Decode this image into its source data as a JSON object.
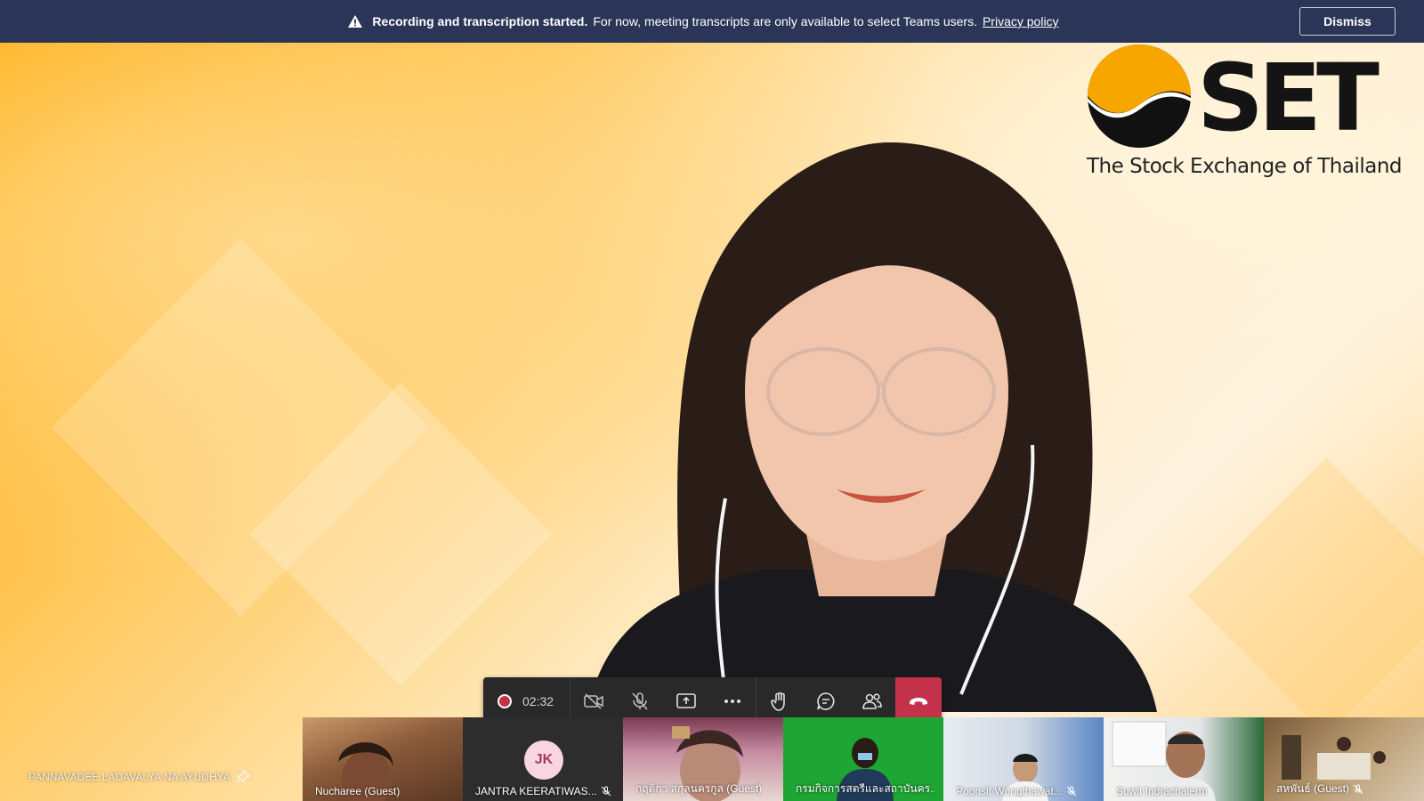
{
  "banner": {
    "title": "Recording and transcription started.",
    "message": "For now, meeting transcripts are only available to select Teams users.",
    "link": "Privacy policy",
    "dismiss_label": "Dismiss",
    "background": "#2b3557"
  },
  "stage": {
    "logo_word": "SET",
    "logo_tagline": "The Stock Exchange of Thailand"
  },
  "pinned": {
    "name": "PANNAVADEE LADAVALYA NA AYUDHYA",
    "icon": "pin-icon"
  },
  "controls": {
    "recording_time": "02:32",
    "buttons": [
      "camera-off-icon",
      "mic-muted-icon",
      "share-screen-icon",
      "more-options-icon",
      "raise-hand-icon",
      "chat-icon",
      "participants-icon",
      "hang-up-icon"
    ],
    "hangup_color": "#c4314b"
  },
  "participants": [
    {
      "name": "Nucharee (Guest)",
      "muted": false
    },
    {
      "name": "JANTRA KEERATIWAS...",
      "initials": "JK",
      "muted": true
    },
    {
      "name": "กฤติกา สกุลนครกูล (Guest)",
      "muted": false
    },
    {
      "name": "กรมกิจการสตรีและสถาบันคร...",
      "muted": false
    },
    {
      "name": "Poonsit Wongthawat...",
      "muted": true
    },
    {
      "name": "Suwit Indrachalerm",
      "muted": false
    },
    {
      "name": "สหพันธ์ (Guest)",
      "muted": true
    }
  ]
}
